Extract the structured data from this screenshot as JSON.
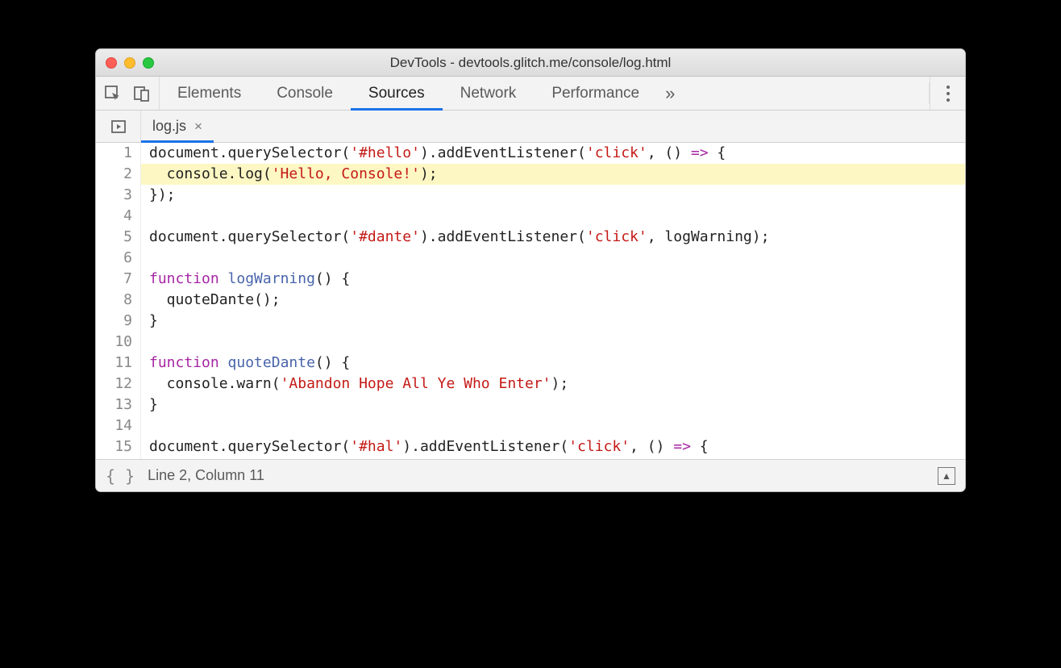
{
  "window": {
    "title": "DevTools - devtools.glitch.me/console/log.html"
  },
  "tabs": {
    "items": [
      "Elements",
      "Console",
      "Sources",
      "Network",
      "Performance"
    ],
    "activeIndex": 2,
    "overflowGlyph": "»"
  },
  "fileTabs": {
    "items": [
      {
        "name": "log.js",
        "active": true
      }
    ]
  },
  "editor": {
    "highlightedLine": 2,
    "lines": [
      {
        "n": 1,
        "tokens": [
          [
            "plain",
            "document.querySelector("
          ],
          [
            "str",
            "'#hello'"
          ],
          [
            "plain",
            ").addEventListener("
          ],
          [
            "str",
            "'click'"
          ],
          [
            "plain",
            ", () "
          ],
          [
            "kw",
            "=>"
          ],
          [
            "plain",
            " {"
          ]
        ]
      },
      {
        "n": 2,
        "tokens": [
          [
            "plain",
            "  console.log("
          ],
          [
            "str",
            "'Hello, Console!'"
          ],
          [
            "plain",
            ");"
          ]
        ]
      },
      {
        "n": 3,
        "tokens": [
          [
            "plain",
            "});"
          ]
        ]
      },
      {
        "n": 4,
        "tokens": [
          [
            "plain",
            ""
          ]
        ]
      },
      {
        "n": 5,
        "tokens": [
          [
            "plain",
            "document.querySelector("
          ],
          [
            "str",
            "'#dante'"
          ],
          [
            "plain",
            ").addEventListener("
          ],
          [
            "str",
            "'click'"
          ],
          [
            "plain",
            ", logWarning);"
          ]
        ]
      },
      {
        "n": 6,
        "tokens": [
          [
            "plain",
            ""
          ]
        ]
      },
      {
        "n": 7,
        "tokens": [
          [
            "kw",
            "function "
          ],
          [
            "def",
            "logWarning"
          ],
          [
            "plain",
            "() {"
          ]
        ]
      },
      {
        "n": 8,
        "tokens": [
          [
            "plain",
            "  quoteDante();"
          ]
        ]
      },
      {
        "n": 9,
        "tokens": [
          [
            "plain",
            "}"
          ]
        ]
      },
      {
        "n": 10,
        "tokens": [
          [
            "plain",
            ""
          ]
        ]
      },
      {
        "n": 11,
        "tokens": [
          [
            "kw",
            "function "
          ],
          [
            "def",
            "quoteDante"
          ],
          [
            "plain",
            "() {"
          ]
        ]
      },
      {
        "n": 12,
        "tokens": [
          [
            "plain",
            "  console.warn("
          ],
          [
            "str",
            "'Abandon Hope All Ye Who Enter'"
          ],
          [
            "plain",
            ");"
          ]
        ]
      },
      {
        "n": 13,
        "tokens": [
          [
            "plain",
            "}"
          ]
        ]
      },
      {
        "n": 14,
        "tokens": [
          [
            "plain",
            ""
          ]
        ]
      },
      {
        "n": 15,
        "tokens": [
          [
            "plain",
            "document.querySelector("
          ],
          [
            "str",
            "'#hal'"
          ],
          [
            "plain",
            ").addEventListener("
          ],
          [
            "str",
            "'click'"
          ],
          [
            "plain",
            ", () "
          ],
          [
            "kw",
            "=>"
          ],
          [
            "plain",
            " {"
          ]
        ]
      }
    ]
  },
  "status": {
    "position": "Line 2, Column 11"
  }
}
